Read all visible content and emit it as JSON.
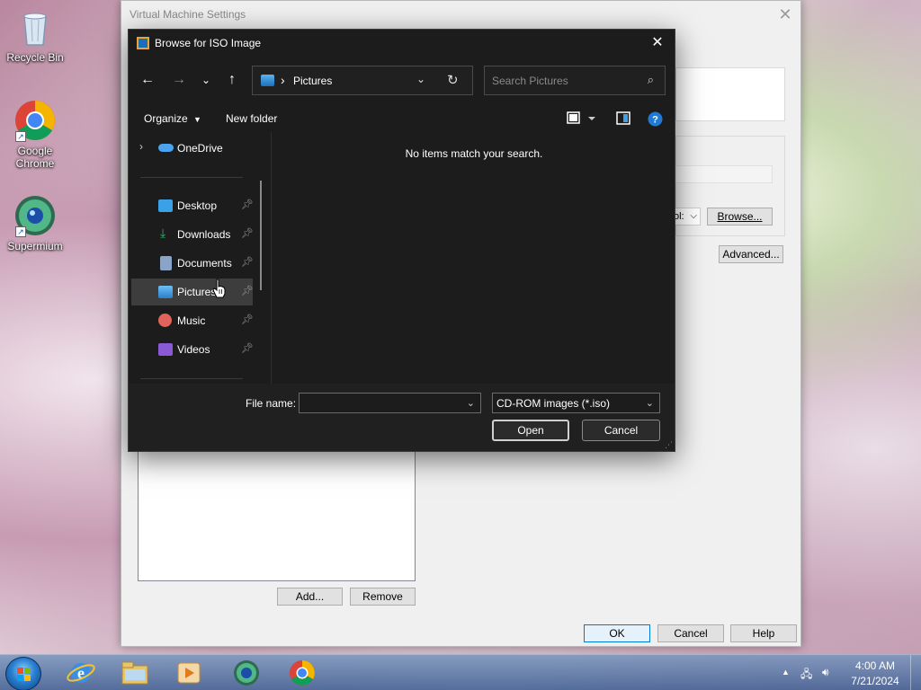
{
  "desktop": {
    "icons": [
      {
        "label": "Recycle Bin"
      },
      {
        "label": "Google Chrome"
      },
      {
        "label": "Supermium"
      }
    ]
  },
  "vm_settings": {
    "title": "Virtual Machine Settings",
    "browse_label": "Browse...",
    "advanced_label": "Advanced...",
    "add_label": "Add...",
    "remove_label": "Remove",
    "ok_label": "OK",
    "cancel_label": "Cancel",
    "help_label": "Help",
    "partial_dropdown_text": "ol:"
  },
  "dialog": {
    "title": "Browse for ISO Image",
    "address": {
      "location": "Pictures"
    },
    "search": {
      "placeholder": "Search Pictures"
    },
    "toolbar": {
      "organize": "Organize",
      "new_folder": "New folder"
    },
    "nav": {
      "onedrive": "OneDrive",
      "items": [
        {
          "label": "Desktop",
          "color": "#3aa0e8"
        },
        {
          "label": "Downloads",
          "color": "#2fb26b"
        },
        {
          "label": "Documents",
          "color": "#8aa4c8"
        },
        {
          "label": "Pictures",
          "color": "#3d95e0",
          "selected": true
        },
        {
          "label": "Music",
          "color": "#e0645a"
        },
        {
          "label": "Videos",
          "color": "#8a5ad6"
        }
      ]
    },
    "empty_message": "No items match your search.",
    "footer": {
      "file_name_label": "File name:",
      "file_name_value": "",
      "file_type": "CD-ROM images (*.iso)",
      "open_label": "Open",
      "cancel_label": "Cancel"
    }
  },
  "taskbar": {
    "time": "4:00 AM",
    "date": "7/21/2024"
  }
}
